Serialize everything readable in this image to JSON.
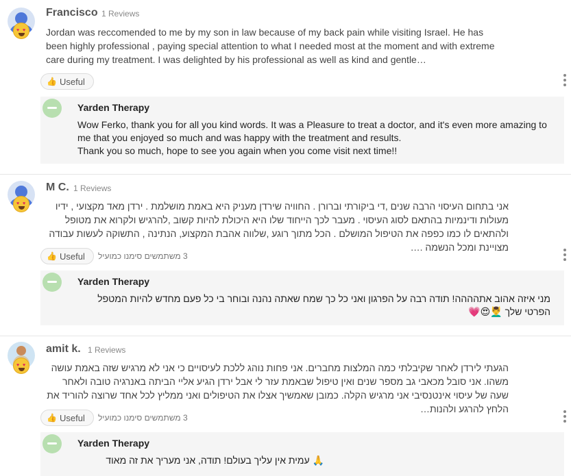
{
  "reviews": [
    {
      "name": "Francisco",
      "count": "1 Reviews",
      "text": "Jordan was reccomended to me by my son in law because of my back pain while visiting Israel. He has been highly professional , paying special attention to what I needed most at the moment and with extreme care during my treatment. I was delighted by his professional as well as kind and gentle…",
      "useful_label": "Useful",
      "marked_text": "",
      "reply": {
        "name": "Yarden Therapy",
        "lines": [
          "Wow Ferko, thank you for all you kind words. It was a Pleasure to treat a doctor, and it's even more amazing to me that you enjoyed so much and was happy with the treatment and results.",
          "Thank you so much, hope to see you again when you come visit next time!!"
        ]
      }
    },
    {
      "name": "M C.",
      "count": "1 Reviews",
      "text": "אני בתחום העיסוי הרבה שנים ,די ביקורתי וברורן . החוויה שירדן מעניק היא באמת מושלמת . ירדן מאד מקצועי , ידיו מעולות ודינמיות בהתאם לסוג העיסוי . מעבר לכך הייחוד שלו היא היכולת להיות קשוב ,להרגיש ולקרוא את מטופל ולהתאים לו כמו כפפה את הטיפול המושלם . הכל מתוך רוגע ,שלווה אהבת המקצוע, הנתינה , התשוקה לעשות עבודה מצויינת ומכל הנשמה .…",
      "useful_label": "Useful",
      "marked_text": "3 משתמשים סימנו כמועיל",
      "reply": {
        "name": "Yarden Therapy",
        "lines": [
          "מני איזה אהוב אתהההה! תודה רבה על הפרגון ואני כל כך שמח שאתה נהנה ובוחר בי כל פעם מחדש להיות המטפל הפרטי שלך 💆‍♂️😍💗"
        ]
      }
    },
    {
      "name": "amit k.",
      "count": "1 Reviews",
      "text": "הגעתי לירדן לאחר שקיבלתי כמה המלצות מחברים. אני פחות נוהג ללכת לעיסויים כי אני לא מרגיש שזה באמת עושה משהו. אני סובל מכאבי גב מספר שנים ואין טיפול שבאמת עזר לי אבל ירדן הגיע אליי הביתה באנרגיה טובה ולאחר שעה של עיסוי אינטנסיבי אני מרגיש הקלה. כמובן שאמשיך אצלו את הטיפולים ואני ממליץ לכל אחד שרוצה להוריד את הלחץ להרגע ולהנות…",
      "useful_label": "Useful",
      "marked_text": "3 משתמשים סימנו כמועיל",
      "reply": {
        "name": "Yarden Therapy",
        "lines": [
          "🙏 עמית אין עליך בעולם! תודה, אני מעריך את זה מאוד"
        ]
      }
    }
  ],
  "icons": {
    "thumb": "thumbs-up-icon",
    "more": "more-vertical-icon",
    "avatar": "user-avatar-icon",
    "badge": "heart-eyes-emoji-icon",
    "logo": "yarden-therapy-logo-icon"
  },
  "colors": {
    "reply_bg": "#f5f5f5",
    "avatar_blue": "#4f78d9",
    "emoji_yellow": "#f6c638"
  }
}
